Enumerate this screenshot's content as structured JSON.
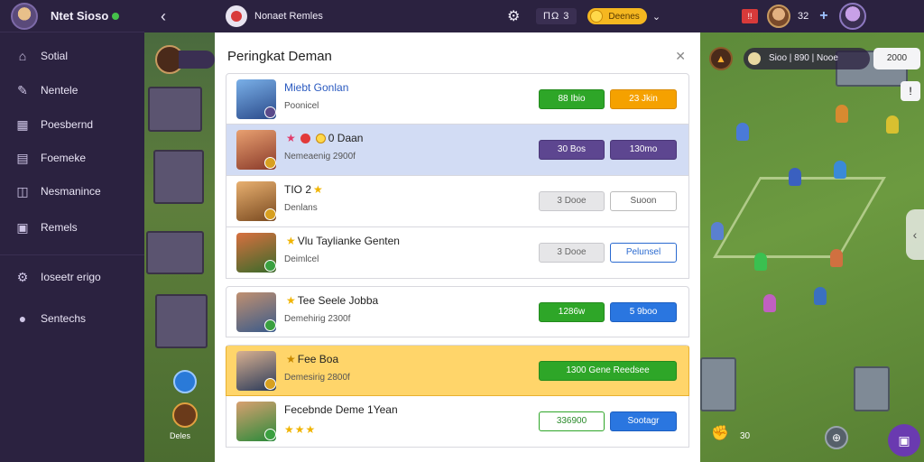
{
  "app": {
    "title": "Ntet Sioso"
  },
  "sidebar": {
    "items": [
      {
        "label": "Sotial",
        "icon": "home-icon"
      },
      {
        "label": "Nentele",
        "icon": "pen-icon"
      },
      {
        "label": "Poesbernd",
        "icon": "table-icon"
      },
      {
        "label": "Foemeke",
        "icon": "note-icon"
      },
      {
        "label": "Nesmanince",
        "icon": "bookmark-icon"
      },
      {
        "label": "Remels",
        "icon": "gift-icon"
      },
      {
        "label": "Ioseetr erigo",
        "icon": "settings-icon"
      },
      {
        "label": "Sentechs",
        "icon": "drop-icon"
      }
    ]
  },
  "topbar": {
    "game_name": "Nonaet Remles",
    "counter": "ΠΩ 3",
    "coin_label": "Deenes",
    "level": "32"
  },
  "left_scene": {
    "label": "Deles"
  },
  "right_scene": {
    "resource": "Sioo | 890 | Nooe",
    "button": "2000",
    "count": "30"
  },
  "panel": {
    "title": "Peringkat Deman",
    "rows": [
      {
        "name": "Miebt Gonlan",
        "sub": "Poonicel",
        "btn1": "88 Ibio",
        "btn2": "23 Jkin",
        "style": "normal"
      },
      {
        "name": "0 Daan",
        "sub": "Nemeaenig 2900f",
        "btn1": "30 Bos",
        "btn2": "130mo",
        "style": "blue"
      },
      {
        "name": "TIO 2",
        "sub": "Denlans",
        "btn1": "3 Dooe",
        "btn2": "Suoon",
        "style": "normal"
      },
      {
        "name": "Vlu Taylianke Genten",
        "sub": "Deimlcel",
        "btn1": "3 Dooe",
        "btn2": "Pelunsel",
        "style": "normal"
      },
      {
        "name": "Tee Seele Jobba",
        "sub": "Demehirig 2300f",
        "btn1": "1286w",
        "btn2": "5 9boo",
        "style": "normal"
      },
      {
        "name": "Fee Boa",
        "sub": "Demesirig 2800f",
        "btn_wide": "1300 Gene Reedsee",
        "style": "gold"
      },
      {
        "name": "Fecebnde Deme 1Yean",
        "sub": "",
        "btn1": "336900",
        "btn2": "Sootagr",
        "style": "normal"
      }
    ]
  },
  "colors": {
    "sidebar": "#2b2240",
    "accent_green": "#2ea628",
    "accent_blue": "#2a76e0",
    "highlight_gold": "#ffd56a"
  }
}
